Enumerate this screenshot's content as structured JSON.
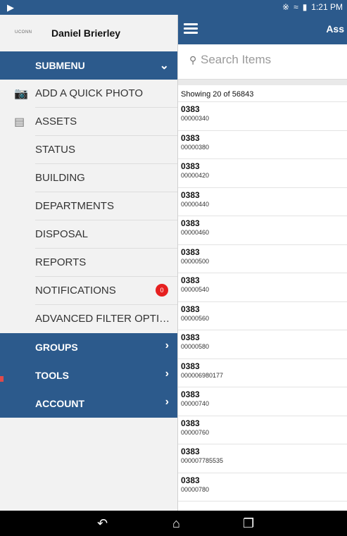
{
  "status_bar": {
    "time": "1:21 PM",
    "left_icon": "play-store-icon",
    "icons": [
      "bluetooth-icon",
      "wifi-icon",
      "battery-icon"
    ]
  },
  "app_bar": {
    "title": "Ass"
  },
  "search": {
    "placeholder": "Search Items"
  },
  "list": {
    "showing": "Showing 20 of 56843",
    "items": [
      {
        "code": "0383",
        "num": "00000340"
      },
      {
        "code": "0383",
        "num": "00000380"
      },
      {
        "code": "0383",
        "num": "00000420"
      },
      {
        "code": "0383",
        "num": "00000440"
      },
      {
        "code": "0383",
        "num": "00000460"
      },
      {
        "code": "0383",
        "num": "00000500"
      },
      {
        "code": "0383",
        "num": "00000540"
      },
      {
        "code": "0383",
        "num": "00000560"
      },
      {
        "code": "0383",
        "num": "00000580"
      },
      {
        "code": "0383",
        "num": "000006980177"
      },
      {
        "code": "0383",
        "num": "00000740"
      },
      {
        "code": "0383",
        "num": "00000760"
      },
      {
        "code": "0383",
        "num": "000007785535"
      },
      {
        "code": "0383",
        "num": "00000780"
      }
    ]
  },
  "drawer": {
    "logo": "UCONN",
    "user_name": "Daniel Brierley",
    "submenu_label": "SUBMENU",
    "items": [
      {
        "label": "ADD A QUICK PHOTO",
        "icon": "camera-icon"
      },
      {
        "label": "ASSETS",
        "icon": "document-icon"
      },
      {
        "label": "STATUS"
      },
      {
        "label": "BUILDING"
      },
      {
        "label": "DEPARTMENTS"
      },
      {
        "label": "DISPOSAL"
      },
      {
        "label": "REPORTS"
      },
      {
        "label": "NOTIFICATIONS",
        "badge": "0"
      },
      {
        "label": "ADVANCED FILTER OPTIONS"
      }
    ],
    "groups_label": "GROUPS",
    "tools_label": "TOOLS",
    "account_label": "ACCOUNT"
  },
  "colors": {
    "primary": "#2c5a8c",
    "badge": "#e62020"
  }
}
